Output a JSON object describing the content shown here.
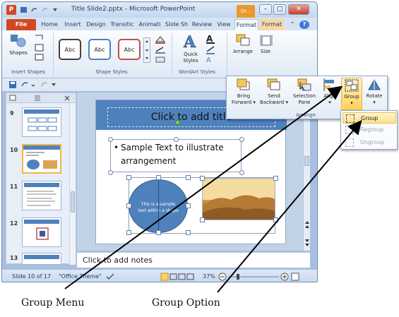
{
  "window": {
    "title": "Title Slide2.pptx - Microsoft PowerPoint",
    "drawing_tools_tab": "Dr...",
    "app_icon": "P"
  },
  "ribbon_tabs": [
    "File",
    "Home",
    "Insert",
    "Design",
    "Transitic",
    "Animati",
    "Slide Sh",
    "Review",
    "View",
    "Format",
    "Format"
  ],
  "ribbon": {
    "shapes_label": "Shapes",
    "insert_shapes_group": "Insert Shapes",
    "shape_styles_group": "Shape Styles",
    "abc_samples": [
      "Abc",
      "Abc",
      "Abc"
    ],
    "quick_styles_label": "Quick Styles",
    "wordart_group": "WordArt Styles",
    "arrange_label": "Arrange",
    "size_label": "Size"
  },
  "slides_panel": {
    "numbers": [
      "9",
      "10",
      "11",
      "12",
      "13"
    ]
  },
  "slide": {
    "title_placeholder": "Click to add title",
    "bullet_text_line1": "Sample Text to illustrate",
    "bullet_text_line2": "arrangement",
    "ellipse_text_line1": "This is a sample",
    "ellipse_text_line2": "text within a shape"
  },
  "notes_placeholder": "Click to add notes",
  "status": {
    "slide_info": "Slide 10 of 17",
    "theme": "\"Office Theme\"",
    "zoom": "37%"
  },
  "arrange_panel": {
    "buttons": [
      {
        "line1": "Bring",
        "line2": "Forward ▾"
      },
      {
        "line1": "Send",
        "line2": "Backward ▾"
      },
      {
        "line1": "Selection",
        "line2": "Pane"
      },
      {
        "line1": "Align",
        "line2": "▾"
      },
      {
        "line1": "Group",
        "line2": "▾"
      },
      {
        "line1": "Rotate",
        "line2": "▾"
      }
    ],
    "group_label": "Arrange"
  },
  "group_menu": {
    "items": [
      "Group",
      "Regroup",
      "Ungroup"
    ],
    "selected": "Group"
  },
  "callouts": {
    "left": "Group Menu",
    "right": "Group Option"
  },
  "colors": {
    "accent": "#4f81bd",
    "file_tab": "#d24726",
    "highlight": "#ffd35b"
  }
}
